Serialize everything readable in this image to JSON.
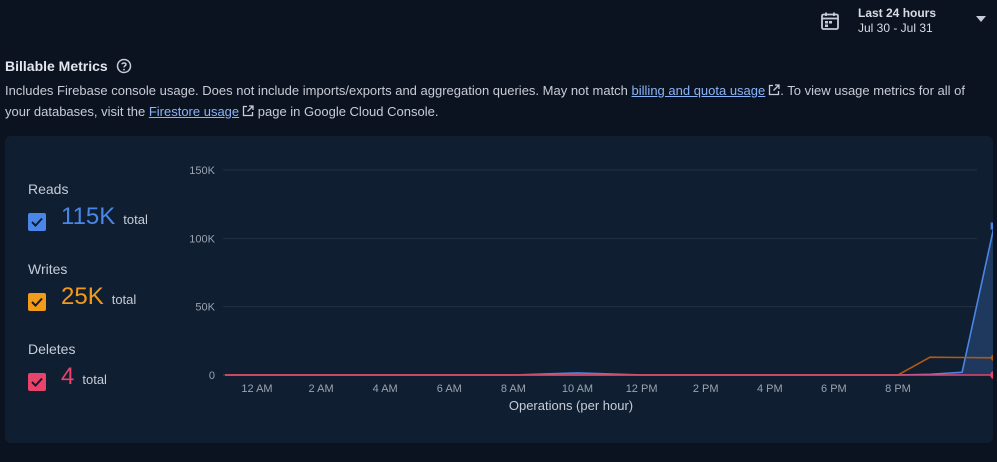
{
  "date_range": {
    "label": "Last 24 hours",
    "dates": "Jul 30 - Jul 31"
  },
  "section": {
    "title": "Billable Metrics",
    "desc_part1": "Includes Firebase console usage. Does not include imports/exports and aggregation queries. May not match ",
    "link1": "billing and quota usage",
    "desc_part2": ". To view usage metrics for all of your databases, visit the ",
    "link2": "Firestore usage",
    "desc_part3": " page in Google Cloud Console."
  },
  "metrics": [
    {
      "name": "Reads",
      "value": "115K",
      "unit": "total",
      "color": "#4a86e8",
      "checked": true
    },
    {
      "name": "Writes",
      "value": "25K",
      "unit": "total",
      "color": "#f29a1a",
      "checked": true
    },
    {
      "name": "Deletes",
      "value": "4",
      "unit": "total",
      "color": "#e8436a",
      "checked": true
    }
  ],
  "chart_data": {
    "type": "line",
    "xlabel": "Operations (per hour)",
    "ylabel": "",
    "ylim": [
      0,
      150000
    ],
    "y_ticks": [
      "0",
      "50K",
      "100K",
      "150K"
    ],
    "y_tick_values": [
      0,
      50000,
      100000,
      150000
    ],
    "x_tick_labels": [
      "12 AM",
      "2 AM",
      "4 AM",
      "6 AM",
      "8 AM",
      "10 AM",
      "12 PM",
      "2 PM",
      "4 PM",
      "6 PM",
      "8 PM"
    ],
    "x_tick_hours": [
      0,
      2,
      4,
      6,
      8,
      10,
      12,
      14,
      16,
      18,
      20
    ],
    "x_range_hours": [
      -1,
      23
    ],
    "grid": true,
    "series": [
      {
        "name": "Reads",
        "color": "#4a86e8",
        "x": [
          -1,
          8,
          9,
          10,
          11,
          12,
          20,
          21,
          22,
          23
        ],
        "y": [
          0,
          0,
          800,
          1500,
          800,
          0,
          0,
          500,
          2000,
          109000
        ]
      },
      {
        "name": "Writes",
        "color": "#b05a12",
        "x": [
          -1,
          20,
          21,
          22,
          23
        ],
        "y": [
          0,
          0,
          13000,
          12800,
          12600
        ]
      },
      {
        "name": "Deletes",
        "color": "#e8436a",
        "x": [
          -1,
          23
        ],
        "y": [
          0,
          4
        ]
      }
    ]
  }
}
